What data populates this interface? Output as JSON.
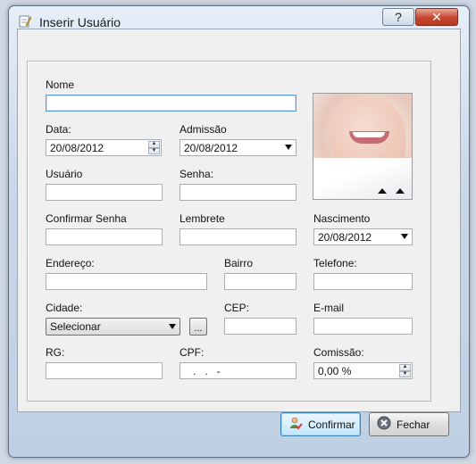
{
  "window": {
    "title": "Inserir Usuário",
    "help_glyph": "?",
    "close_glyph": "✕"
  },
  "form": {
    "nome_label": "Nome",
    "data_label": "Data:",
    "data_value": "20/08/2012",
    "admissao_label": "Admissão",
    "admissao_value": "20/08/2012",
    "usuario_label": "Usuário",
    "senha_label": "Senha:",
    "confirmar_senha_label": "Confirmar Senha",
    "lembrete_label": "Lembrete",
    "nascimento_label": "Nascimento",
    "nascimento_value": "20/08/2012",
    "endereco_label": "Endereço:",
    "bairro_label": "Bairro",
    "telefone_label": "Telefone:",
    "cidade_label": "Cidade:",
    "cidade_value": "Selecionar",
    "dots_label": "...",
    "cep_label": "CEP:",
    "email_label": "E-mail",
    "rg_label": "RG:",
    "cpf_label": "CPF:",
    "cpf_mask": "   .   .   -",
    "comissao_label": "Comissão:",
    "comissao_value": "0,00 %"
  },
  "buttons": {
    "confirmar": "Confirmar",
    "fechar": "Fechar"
  },
  "icons": {
    "app": "notepad-icon",
    "confirm": "user-confirm-icon",
    "close": "close-circle-icon"
  },
  "colors": {
    "accent": "#3c7fb1",
    "close_red": "#c6472f"
  }
}
